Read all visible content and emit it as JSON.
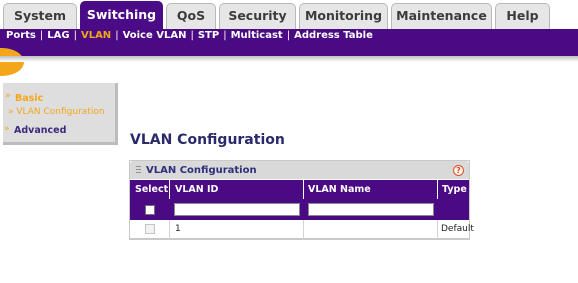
{
  "tabs": [
    {
      "label": "System",
      "active": false
    },
    {
      "label": "Switching",
      "active": true
    },
    {
      "label": "QoS",
      "active": false
    },
    {
      "label": "Security",
      "active": false
    },
    {
      "label": "Monitoring",
      "active": false
    },
    {
      "label": "Maintenance",
      "active": false
    },
    {
      "label": "Help",
      "active": false
    }
  ],
  "subnav": {
    "items": [
      "Ports",
      "LAG",
      "VLAN",
      "Voice VLAN",
      "STP",
      "Multicast",
      "Address Table"
    ],
    "active": "VLAN",
    "active_color": "#f4a61b"
  },
  "leftmenu": {
    "basic_label": "Basic",
    "basic_arrow": "»",
    "vlan_config_label": "» VLAN Configuration",
    "advanced_label": "Advanced",
    "advanced_arrow": "»"
  },
  "main": {
    "title": "VLAN Configuration",
    "panel": {
      "title": "VLAN Configuration",
      "help_icon": "?",
      "columns": [
        "Select",
        "VLAN ID",
        "VLAN Name",
        "Type"
      ],
      "input_row": {
        "vlan_id": "",
        "vlan_name": ""
      },
      "rows": [
        {
          "vlan_id": "1",
          "vlan_name": "",
          "type": "Default"
        }
      ]
    }
  },
  "colors": {
    "brand_purple": "#4a0a83",
    "accent_orange": "#f4a61b"
  }
}
